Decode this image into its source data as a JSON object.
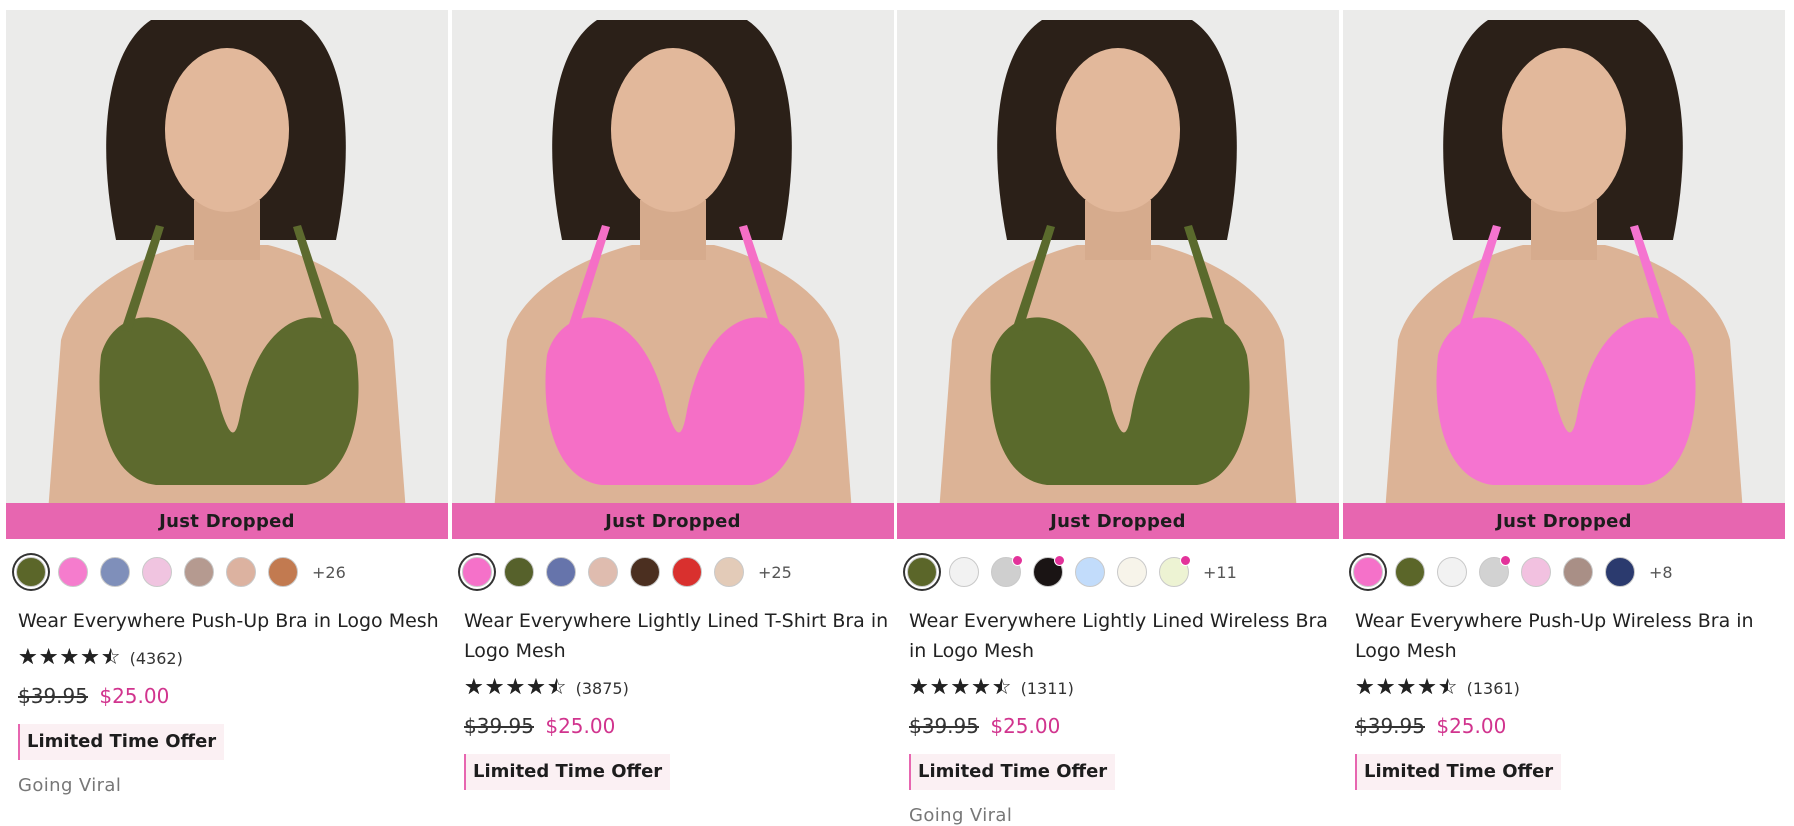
{
  "products": [
    {
      "badge": "Just Dropped",
      "title": "Wear Everywhere Push-Up Bra in Logo Mesh",
      "rating_value": 4.5,
      "review_count": "(4362)",
      "price_original": "$39.95",
      "price_sale": "$25.00",
      "offer": "Limited Time Offer",
      "tag": "Going Viral",
      "more_colors": "+26",
      "bra_color": "#5d6a2e",
      "swatches": [
        {
          "color": "#5b6629",
          "selected": true,
          "new": false
        },
        {
          "color": "#f57ccd",
          "selected": false,
          "new": false
        },
        {
          "color": "#7f8fba",
          "selected": false,
          "new": false
        },
        {
          "color": "#f0c4e0",
          "selected": false,
          "new": false
        },
        {
          "color": "#b59a90",
          "selected": false,
          "new": false
        },
        {
          "color": "#dcb2a0",
          "selected": false,
          "new": false
        },
        {
          "color": "#c27a50",
          "selected": false,
          "new": false
        }
      ]
    },
    {
      "badge": "Just Dropped",
      "title": "Wear Everywhere Lightly Lined T-Shirt Bra in Logo Mesh",
      "rating_value": 4.5,
      "review_count": "(3875)",
      "price_original": "$39.95",
      "price_sale": "$25.00",
      "offer": "Limited Time Offer",
      "tag": "",
      "more_colors": "+25",
      "bra_color": "#f56fc6",
      "swatches": [
        {
          "color": "#f571c9",
          "selected": true,
          "new": false
        },
        {
          "color": "#56612b",
          "selected": false,
          "new": false
        },
        {
          "color": "#6674ab",
          "selected": false,
          "new": false
        },
        {
          "color": "#dfbcaf",
          "selected": false,
          "new": false
        },
        {
          "color": "#4b2f20",
          "selected": false,
          "new": false
        },
        {
          "color": "#d9302e",
          "selected": false,
          "new": false
        },
        {
          "color": "#e3cbb8",
          "selected": false,
          "new": false
        }
      ]
    },
    {
      "badge": "Just Dropped",
      "title": "Wear Everywhere Lightly Lined Wireless Bra in Logo Mesh",
      "rating_value": 4.5,
      "review_count": "(1311)",
      "price_original": "$39.95",
      "price_sale": "$25.00",
      "offer": "Limited Time Offer",
      "tag": "Going Viral",
      "more_colors": "+11",
      "bra_color": "#5a6a2c",
      "swatches": [
        {
          "color": "#5b6629",
          "selected": true,
          "new": false
        },
        {
          "color": "#f2f2f2",
          "selected": false,
          "new": false
        },
        {
          "color": "#cfcfcf",
          "selected": false,
          "new": true
        },
        {
          "color": "#1a1414",
          "selected": false,
          "new": true
        },
        {
          "color": "#c2dcfb",
          "selected": false,
          "new": false
        },
        {
          "color": "#f7f4ea",
          "selected": false,
          "new": false
        },
        {
          "color": "#edf3d3",
          "selected": false,
          "new": true
        }
      ]
    },
    {
      "badge": "Just Dropped",
      "title": "Wear Everywhere Push-Up Wireless Bra in Logo Mesh",
      "rating_value": 4.5,
      "review_count": "(1361)",
      "price_original": "$39.95",
      "price_sale": "$25.00",
      "offer": "Limited Time Offer",
      "tag": "",
      "more_colors": "+8",
      "bra_color": "#f574d0",
      "swatches": [
        {
          "color": "#f571c9",
          "selected": true,
          "new": false
        },
        {
          "color": "#5b6629",
          "selected": false,
          "new": false
        },
        {
          "color": "#f2f2f2",
          "selected": false,
          "new": false
        },
        {
          "color": "#d2d2d2",
          "selected": false,
          "new": true
        },
        {
          "color": "#f2c1e0",
          "selected": false,
          "new": false
        },
        {
          "color": "#a98f86",
          "selected": false,
          "new": false
        },
        {
          "color": "#2b3a6e",
          "selected": false,
          "new": false
        }
      ]
    }
  ]
}
